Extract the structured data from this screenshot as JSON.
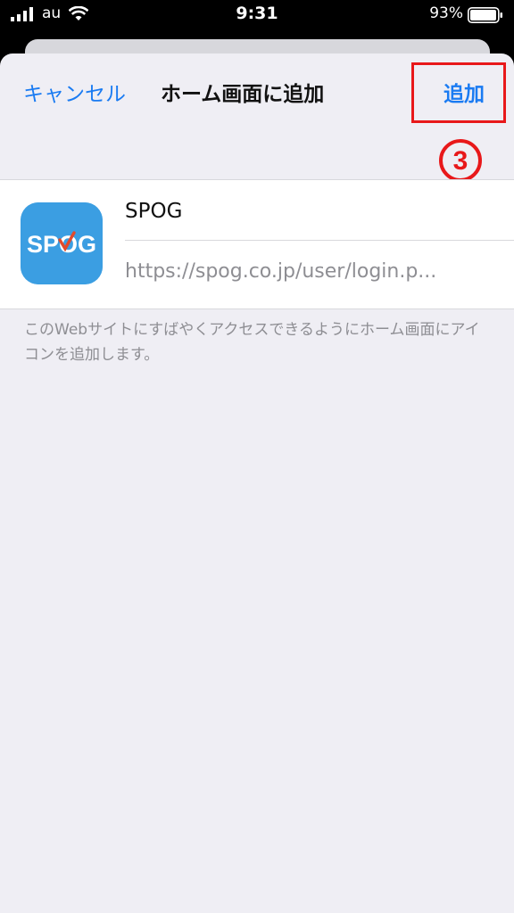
{
  "status_bar": {
    "carrier": "au",
    "time": "9:31",
    "battery": "93%",
    "icons": [
      "signal-icon",
      "wifi-icon",
      "battery-icon"
    ]
  },
  "sheet": {
    "cancel_label": "キャンセル",
    "title": "ホーム画面に追加",
    "add_label": "追加",
    "step_marker": "3",
    "app": {
      "name": "SPOG",
      "url": "https://spog.co.jp/user/login.p...",
      "icon_text": "SPOG",
      "icon_color": "#3b9ee2"
    },
    "caption": "このWebサイトにすばやくアクセスできるようにホーム画面にアイコンを追加します。"
  },
  "colors": {
    "accent": "#1a7bf2",
    "annotation": "#e8181a"
  }
}
